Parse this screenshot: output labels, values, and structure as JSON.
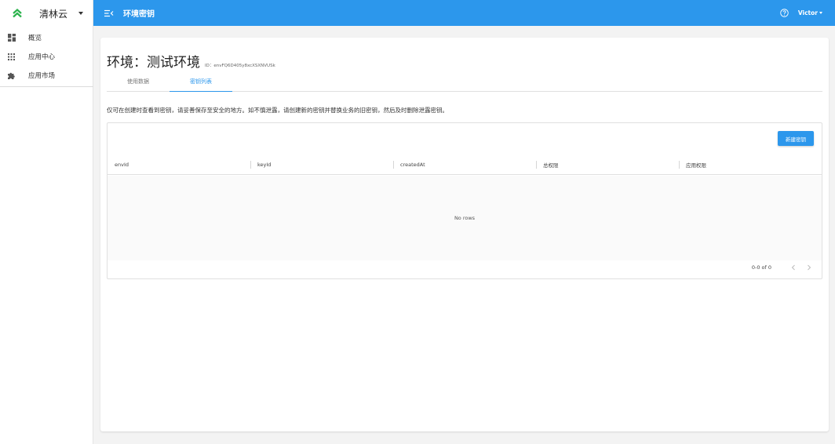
{
  "brand": {
    "name": "清林云",
    "icon": "double-chevron-up-icon",
    "accent": "#2bb24c"
  },
  "sidebar": {
    "items": [
      {
        "label": "概览",
        "icon": "dashboard-icon"
      },
      {
        "label": "应用中心",
        "icon": "apps-grid-icon"
      },
      {
        "label": "应用市场",
        "icon": "puzzle-icon"
      }
    ]
  },
  "header": {
    "title": "环境密钥",
    "user": "Victor",
    "color": "#2c97ec"
  },
  "page": {
    "title": "环境：测试环境",
    "env_id": "ID：envFQ6D405y8xcXSXNVUSk",
    "tabs": [
      {
        "label": "使用数据",
        "active": false
      },
      {
        "label": "密钥列表",
        "active": true
      }
    ],
    "notice": "仅可在创建时查看到密钥，请妥善保存至安全的地方。如不慎泄露，请创建新的密钥并替换业务的旧密钥，然后及时删除泄露密钥。"
  },
  "table": {
    "add_button": "新建密钥",
    "columns": [
      "envId",
      "keyId",
      "createdAt",
      "总权限",
      "应用权限"
    ],
    "empty_text": "No rows",
    "pagination": "0-0 of 0"
  }
}
